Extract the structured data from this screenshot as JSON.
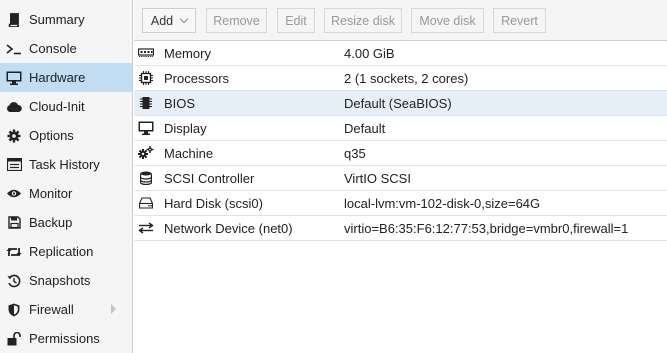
{
  "sidebar": {
    "items": [
      {
        "label": "Summary",
        "icon": "book-icon"
      },
      {
        "label": "Console",
        "icon": "terminal-icon"
      },
      {
        "label": "Hardware",
        "icon": "desktop-icon",
        "active": true
      },
      {
        "label": "Cloud-Init",
        "icon": "cloud-icon"
      },
      {
        "label": "Options",
        "icon": "gear-icon"
      },
      {
        "label": "Task History",
        "icon": "list-icon"
      },
      {
        "label": "Monitor",
        "icon": "eye-icon"
      },
      {
        "label": "Backup",
        "icon": "floppy-icon"
      },
      {
        "label": "Replication",
        "icon": "retweet-icon"
      },
      {
        "label": "Snapshots",
        "icon": "history-icon"
      },
      {
        "label": "Firewall",
        "icon": "shield-icon"
      },
      {
        "label": "Permissions",
        "icon": "unlock-icon"
      }
    ]
  },
  "toolbar": {
    "add_label": "Add",
    "remove_label": "Remove",
    "edit_label": "Edit",
    "resize_label": "Resize disk",
    "move_label": "Move disk",
    "revert_label": "Revert"
  },
  "hardware": {
    "rows": [
      {
        "key": "Memory",
        "value": "4.00 GiB",
        "icon": "memory-icon"
      },
      {
        "key": "Processors",
        "value": "2 (1 sockets, 2 cores)",
        "icon": "cpu-icon"
      },
      {
        "key": "BIOS",
        "value": "Default (SeaBIOS)",
        "icon": "microchip-icon",
        "selected": true
      },
      {
        "key": "Display",
        "value": "Default",
        "icon": "monitor-icon"
      },
      {
        "key": "Machine",
        "value": "q35",
        "icon": "cogs-icon"
      },
      {
        "key": "SCSI Controller",
        "value": "VirtIO SCSI",
        "icon": "database-icon"
      },
      {
        "key": "Hard Disk (scsi0)",
        "value": "local-lvm:vm-102-disk-0,size=64G",
        "icon": "hdd-icon"
      },
      {
        "key": "Network Device (net0)",
        "value": "virtio=B6:35:F6:12:77:53,bridge=vmbr0,firewall=1",
        "icon": "exchange-icon"
      }
    ]
  },
  "colors": {
    "active_nav": "#c2ddf2",
    "selected_row": "#e6eff7",
    "toolbar_bg": "#f5f5f5"
  }
}
